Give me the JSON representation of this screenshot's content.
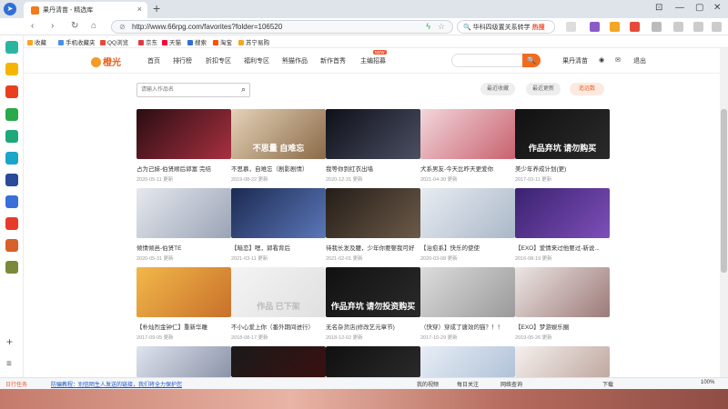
{
  "browser": {
    "tab_title": "果丹清苗 - 精选库",
    "new_tab": "+",
    "url": "http://www.66rpg.com/favorites?folder=106520",
    "search_query": "华科四级置关系转学",
    "search_hot": "热搜"
  },
  "bookmarks": [
    "收藏",
    "手机收藏夹",
    "QQ浏览",
    "京东",
    "天猫",
    "搜索",
    "淘宝",
    "苏宁易购"
  ],
  "site": {
    "logo": "橙光",
    "nav": [
      "首页",
      "排行榜",
      "折扣专区",
      "福利专区",
      "熊猫作品",
      "新作首秀",
      "主编招募"
    ],
    "nav_badge": "NEW",
    "search_button": "🔍",
    "user": {
      "name": "果丹清苗",
      "logout": "退出"
    }
  },
  "toolbar": {
    "search_placeholder": "请输入作品名",
    "buttons": [
      {
        "label": "最近收藏",
        "active": false
      },
      {
        "label": "最近更新",
        "active": false
      },
      {
        "label": "追远数",
        "active": true
      }
    ]
  },
  "cards": [
    {
      "title": "占为己妹-伯贤顺后郭富 完结",
      "meta": "2020-05-11 更新",
      "overlay": "",
      "colors": [
        "#2a0d12",
        "#a83040"
      ]
    },
    {
      "title": "不思慕，自难忘（剧影剧情）",
      "meta": "2019-08-22 更新",
      "overlay": "不思量 自难忘",
      "colors": [
        "#e5d2b8",
        "#8a6a48"
      ]
    },
    {
      "title": "我等你到红衣出墙",
      "meta": "2020-12-31 更新",
      "overlay": "",
      "colors": [
        "#0e1018",
        "#4b4f63"
      ]
    },
    {
      "title": "犬系男友-今天比昨天更爱你",
      "meta": "2021-04-30 更新",
      "overlay": "",
      "colors": [
        "#f3d6dc",
        "#c8626e"
      ]
    },
    {
      "title": "美少年养成计划(更)",
      "meta": "2017-03-11 更新",
      "overlay": "作品弃坑 请勿购买",
      "colors": [
        "#111111",
        "#2a2a2a"
      ]
    },
    {
      "title": "倾情倾邑-伯贤TE",
      "meta": "2020-05-31 更新",
      "overlay": "",
      "colors": [
        "#e6e8ee",
        "#9aa4b6"
      ]
    },
    {
      "title": "【暗恋】嗯，郭看背后",
      "meta": "2021-03-11 更新",
      "overlay": "",
      "colors": [
        "#1c2a52",
        "#5a77b8"
      ]
    },
    {
      "title": "待我长发及腰，少年你要娶我可好",
      "meta": "2021-02-01 更新",
      "overlay": "",
      "colors": [
        "#241d18",
        "#6c5a48"
      ]
    },
    {
      "title": "【治愈系】快乐的使使",
      "meta": "2020-03-08 更新",
      "overlay": "",
      "colors": [
        "#e8ecf2",
        "#aab8c8"
      ]
    },
    {
      "title": "【EXO】爱情来过他要过-新说...",
      "meta": "2016-08-19 更新",
      "overlay": "",
      "colors": [
        "#3a2270",
        "#7e4fb8"
      ]
    },
    {
      "title": "【朴灿烈金钟仁】重新华雕",
      "meta": "2017-09-05 更新",
      "overlay": "",
      "colors": [
        "#f2b84a",
        "#c8702a"
      ]
    },
    {
      "title": "不小心爱上你（番外期间进行）",
      "meta": "2018-08-17 更新",
      "overlay": "作品 已下架",
      "colors": [
        "#f4f4f4",
        "#e0e0e0"
      ]
    },
    {
      "title": "无名杂货店(修改艺元章节)",
      "meta": "2018-12-02 更新",
      "overlay": "作品弃坑 请勿投资购买",
      "colors": [
        "#111111",
        "#2a2a2a"
      ]
    },
    {
      "title": "（快穿）穿成了唐效的猫？！！",
      "meta": "2017-10-29 更新",
      "overlay": "",
      "colors": [
        "#dcdcdc",
        "#9a9a9a"
      ]
    },
    {
      "title": "【EXO】梦游娱乐圈",
      "meta": "2019-05-26 更新",
      "overlay": "",
      "colors": [
        "#ece6e4",
        "#9c7a78"
      ]
    },
    {
      "title": "",
      "meta": "",
      "overlay": "",
      "colors": [
        "#dfe3ee",
        "#8a93a8"
      ]
    },
    {
      "title": "",
      "meta": "",
      "overlay": "",
      "colors": [
        "#1a1a1a",
        "#3a1010"
      ]
    },
    {
      "title": "",
      "meta": "",
      "overlay": "",
      "colors": [
        "#101010",
        "#2a2a2a"
      ]
    },
    {
      "title": "",
      "meta": "",
      "overlay": "",
      "colors": [
        "#e8eef6",
        "#b0c2d8"
      ]
    },
    {
      "title": "",
      "meta": "",
      "overlay": "",
      "colors": [
        "#f4f0ee",
        "#c0a8a0"
      ]
    }
  ],
  "statusbar": {
    "left": "日行任务",
    "notice": "防骗教程：别信陌生人发送的链接，我们将全力保护您",
    "items": [
      "我的视频",
      "每日关注",
      "网络查询",
      "下载",
      "100%"
    ]
  }
}
